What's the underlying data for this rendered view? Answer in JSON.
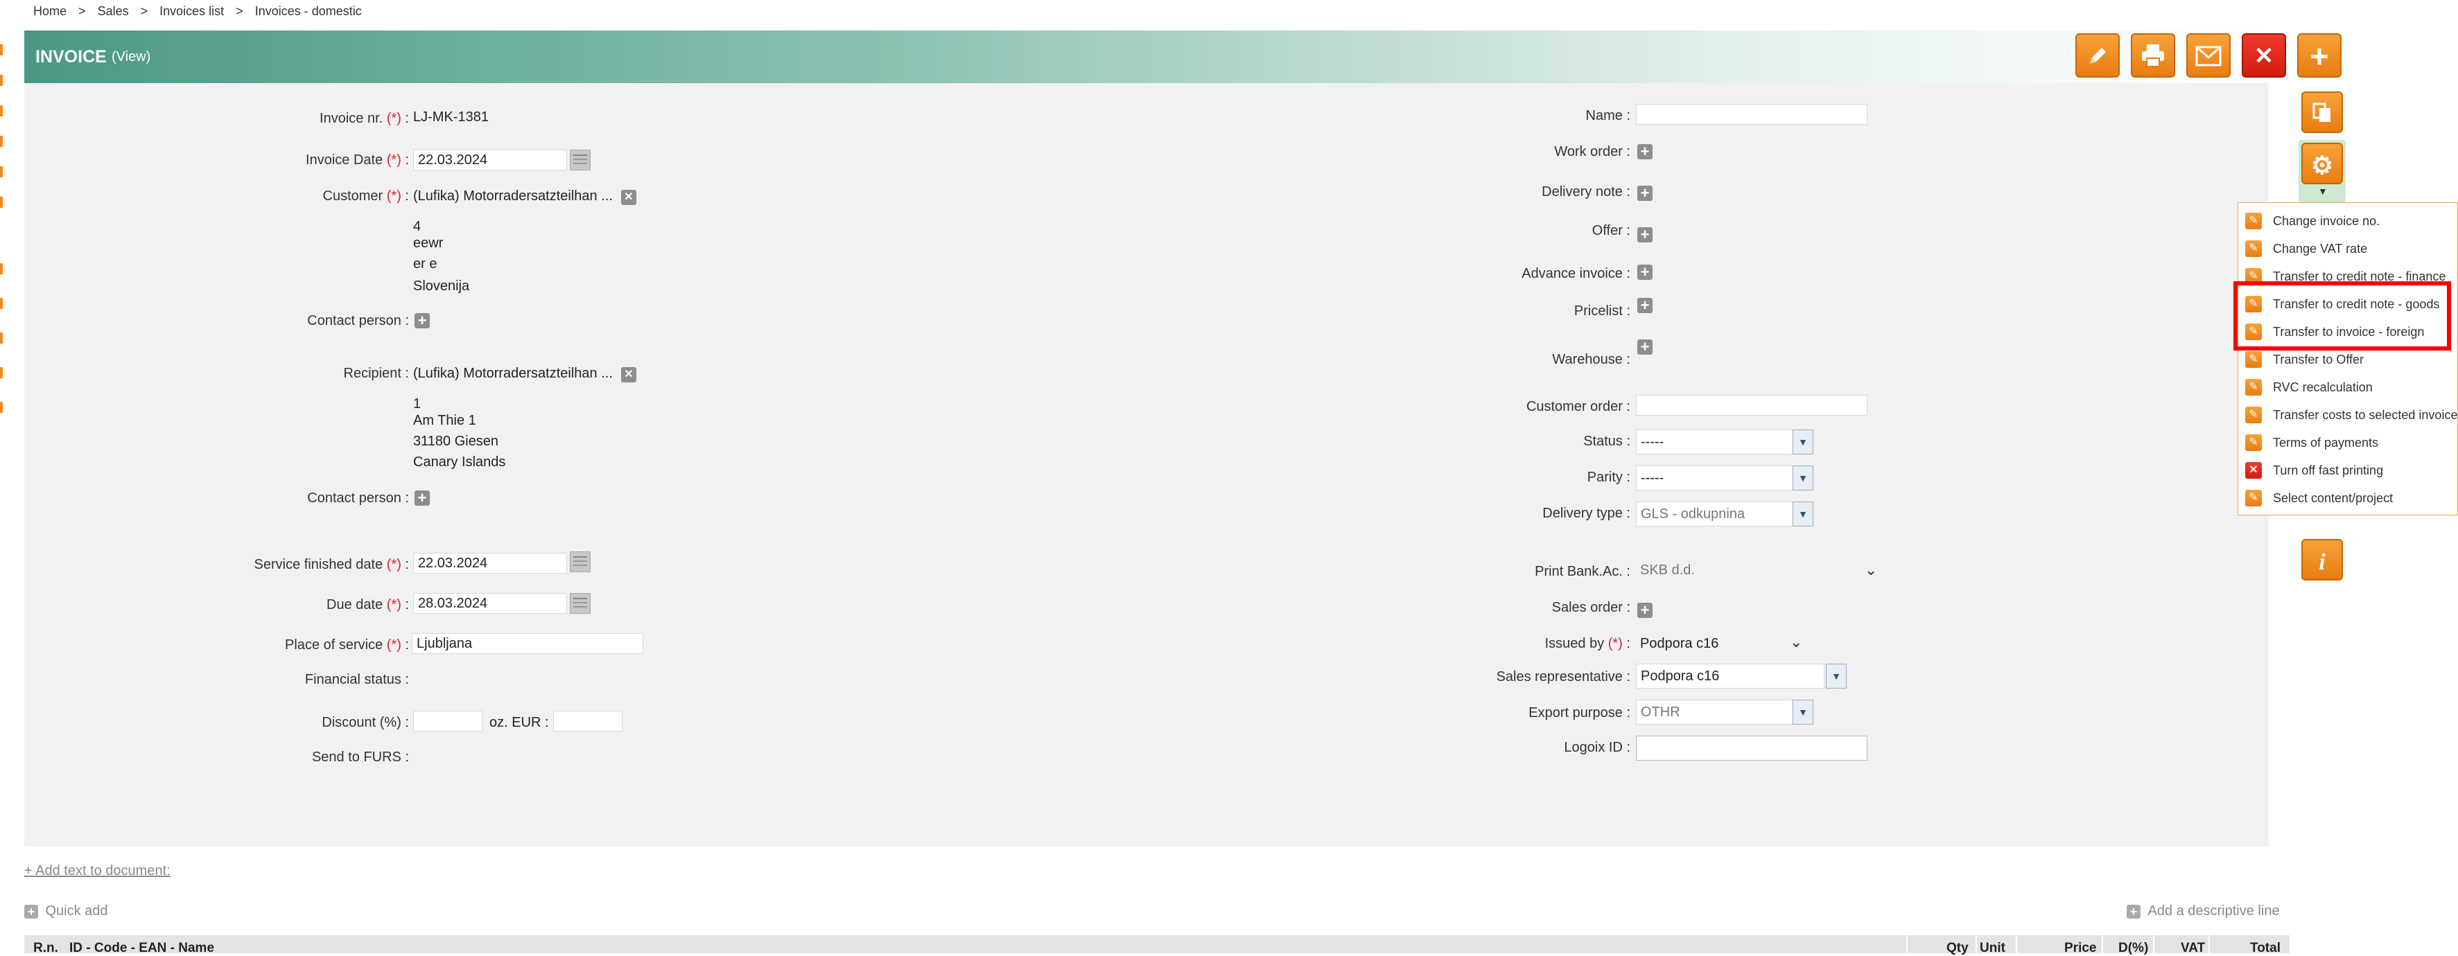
{
  "breadcrumb": [
    "Home",
    "Sales",
    "Invoices list",
    "Invoices - domestic"
  ],
  "breadcrumb_sep": ">",
  "header": {
    "title": "INVOICE",
    "mode": "(View)"
  },
  "required_marker": "(*)",
  "left": {
    "invoice_nr": {
      "label": "Invoice nr.",
      "value": "LJ-MK-1381"
    },
    "invoice_date": {
      "label": "Invoice Date",
      "value": "22.03.2024"
    },
    "customer": {
      "label": "Customer",
      "value": "(Lufika) Motorradersatzteilhan ...",
      "address": [
        "4",
        "eewr",
        "er e",
        "Slovenija"
      ]
    },
    "contact_person_1": {
      "label": "Contact person :"
    },
    "recipient": {
      "label": "Recipient :",
      "value": "(Lufika) Motorradersatzteilhan ...",
      "address": [
        "1",
        "Am Thie 1",
        "31180 Giesen",
        "Canary Islands"
      ]
    },
    "contact_person_2": {
      "label": "Contact person :"
    },
    "service_finished_date": {
      "label": "Service finished date",
      "value": "22.03.2024"
    },
    "due_date": {
      "label": "Due date",
      "value": "28.03.2024"
    },
    "place_of_service": {
      "label": "Place of service",
      "value": "Ljubljana"
    },
    "financial_status": {
      "label": "Financial status :"
    },
    "discount": {
      "label": "Discount (%) :",
      "eur_label": "oz. EUR :",
      "value": "",
      "eur_value": ""
    },
    "send_to_furs": {
      "label": "Send to FURS :"
    }
  },
  "right": {
    "name": {
      "label": "Name :",
      "value": ""
    },
    "work_order": {
      "label": "Work order :"
    },
    "delivery_note": {
      "label": "Delivery note :"
    },
    "offer": {
      "label": "Offer :"
    },
    "advance_invoice": {
      "label": "Advance invoice :"
    },
    "pricelist": {
      "label": "Pricelist :"
    },
    "warehouse": {
      "label": "Warehouse :"
    },
    "customer_order": {
      "label": "Customer order :",
      "value": ""
    },
    "status": {
      "label": "Status :",
      "value": "-----"
    },
    "parity": {
      "label": "Parity :",
      "value": "-----"
    },
    "delivery_type": {
      "label": "Delivery type :",
      "value": "GLS - odkupnina"
    },
    "print_bank": {
      "label": "Print Bank.Ac. :",
      "value": "SKB d.d."
    },
    "sales_order": {
      "label": "Sales order :"
    },
    "issued_by": {
      "label": "Issued by",
      "value": "Podpora c16"
    },
    "sales_rep": {
      "label": "Sales representative :",
      "value": "Podpora c16"
    },
    "export_purpose": {
      "label": "Export purpose :",
      "value": "OTHR"
    },
    "logoix_id": {
      "label": "Logoix ID :",
      "value": ""
    }
  },
  "menu": {
    "items": [
      {
        "label": "Change invoice no.",
        "icon": "pencil-icon"
      },
      {
        "label": "Change VAT rate",
        "icon": "pencil-icon"
      },
      {
        "label": "Transfer to credit note - finance",
        "icon": "pencil-icon"
      },
      {
        "label": "Transfer to credit note - goods",
        "icon": "pencil-icon"
      },
      {
        "label": "Transfer to invoice - foreign",
        "icon": "pencil-icon"
      },
      {
        "label": "Transfer to Offer",
        "icon": "pencil-icon"
      },
      {
        "label": "RVC recalculation",
        "icon": "pencil-icon"
      },
      {
        "label": "Transfer costs to selected invoice",
        "icon": "pencil-icon"
      },
      {
        "label": "Terms of payments",
        "icon": "pencil-icon"
      },
      {
        "label": "Turn off fast printing",
        "icon": "close-icon"
      },
      {
        "label": "Select content/project",
        "icon": "pencil-icon"
      }
    ],
    "highlight_color": "#ff0000"
  },
  "bottom": {
    "add_text": "+ Add text to document:",
    "quick_add": "Quick add",
    "add_descriptive": "Add a descriptive line",
    "columns": {
      "rn": "R.n.",
      "id": "ID - Code - EAN - Name",
      "qty": "Qty",
      "unit": "Unit",
      "price": "Price",
      "discount": "D(%)",
      "vat": "VAT",
      "total": "Total"
    }
  },
  "colors": {
    "header_start": "#4a9884",
    "panel_bg": "#f1f1f1",
    "accent_orange": "#f08a1a",
    "required": "#d9232f"
  }
}
